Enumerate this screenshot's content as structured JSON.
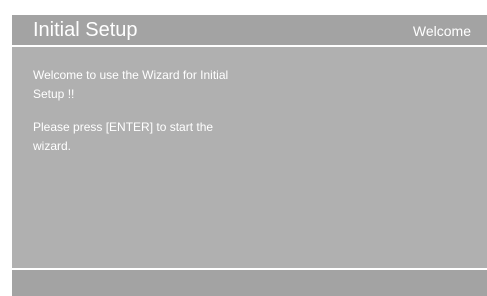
{
  "header": {
    "title": "Initial Setup",
    "step_label": "Welcome"
  },
  "content": {
    "welcome_message": "Welcome to use the Wizard for Initial Setup !!",
    "instruction_message": "Please press [ENTER] to start the wizard."
  },
  "colors": {
    "frame_background": "#a3a3a3",
    "content_background": "#b0b0b0",
    "text": "#ffffff"
  }
}
